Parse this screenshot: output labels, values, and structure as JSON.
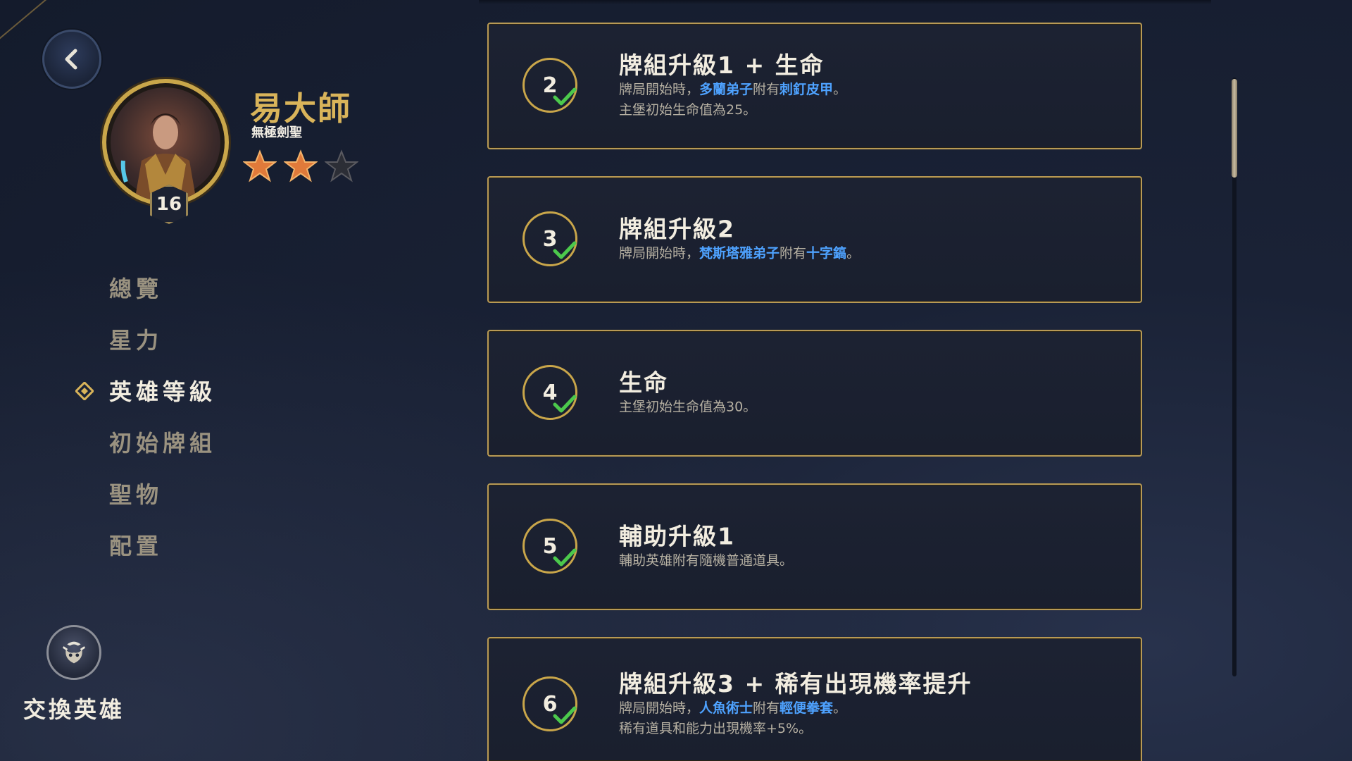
{
  "hero": {
    "name": "易大師",
    "title": "無極劍聖",
    "level": "16",
    "stars_filled": 2,
    "stars_total": 3
  },
  "nav": {
    "items": [
      {
        "label": "總覽",
        "active": false
      },
      {
        "label": "星力",
        "active": false
      },
      {
        "label": "英雄等級",
        "active": true
      },
      {
        "label": "初始牌組",
        "active": false
      },
      {
        "label": "聖物",
        "active": false
      },
      {
        "label": "配置",
        "active": false
      }
    ]
  },
  "swap": {
    "label": "交換英雄",
    "icon": "swap-hero-icon"
  },
  "cards": [
    {
      "level": "2",
      "title": "牌組升級1 + 生命",
      "line1": {
        "pre": "牌局開始時，",
        "kw1": "多蘭弟子",
        "mid": "附有",
        "kw2": "刺釘皮甲",
        "post": "。"
      },
      "line2": "主堡初始生命值為25。"
    },
    {
      "level": "3",
      "title": "牌組升級2",
      "line1": {
        "pre": "牌局開始時，",
        "kw1": "梵斯塔雅弟子",
        "mid": "附有",
        "kw2": "十字鎬",
        "post": "。"
      },
      "line2": ""
    },
    {
      "level": "4",
      "title": "生命",
      "line1": {
        "pre": "主堡初始生命值為30。",
        "kw1": "",
        "mid": "",
        "kw2": "",
        "post": ""
      },
      "line2": ""
    },
    {
      "level": "5",
      "title": "輔助升級1",
      "line1": {
        "pre": "輔助英雄附有隨機普通道具。",
        "kw1": "",
        "mid": "",
        "kw2": "",
        "post": ""
      },
      "line2": ""
    },
    {
      "level": "6",
      "title": "牌組升級3 + 稀有出現機率提升",
      "line1": {
        "pre": "牌局開始時，",
        "kw1": "人魚術士",
        "mid": "附有",
        "kw2": "輕便拳套",
        "post": "。"
      },
      "line2": "稀有道具和能力出現機率+5%。"
    }
  ],
  "colors": {
    "gold": "#c9a64a",
    "keyword": "#4ea2ff",
    "check": "#4cc94c"
  }
}
